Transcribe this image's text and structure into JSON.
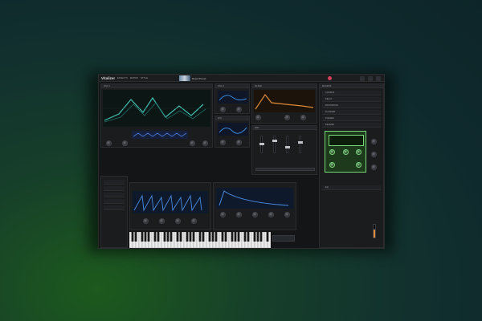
{
  "app": {
    "title": "Vitalizer"
  },
  "topbar": {
    "nav": [
      "EFFECTS",
      "MATRIX",
      "STYLE"
    ],
    "preset_name": "Reset Preset"
  },
  "sections": {
    "osc1": "OSC 1",
    "osc2": "OSC 2",
    "filter": "FILTER",
    "env": "ENV",
    "lfo": "LFO",
    "macros": "MACROS",
    "sidebar_items": [
      "CHORUS",
      "DELAY",
      "DISTORTION",
      "FLANGER",
      "PHASER",
      "REVERB",
      "EQ"
    ]
  },
  "colors": {
    "accent_green": "#78d878",
    "accent_teal": "#3fc0b0",
    "accent_orange": "#e08a3a",
    "accent_blue": "#3a8ad8"
  }
}
